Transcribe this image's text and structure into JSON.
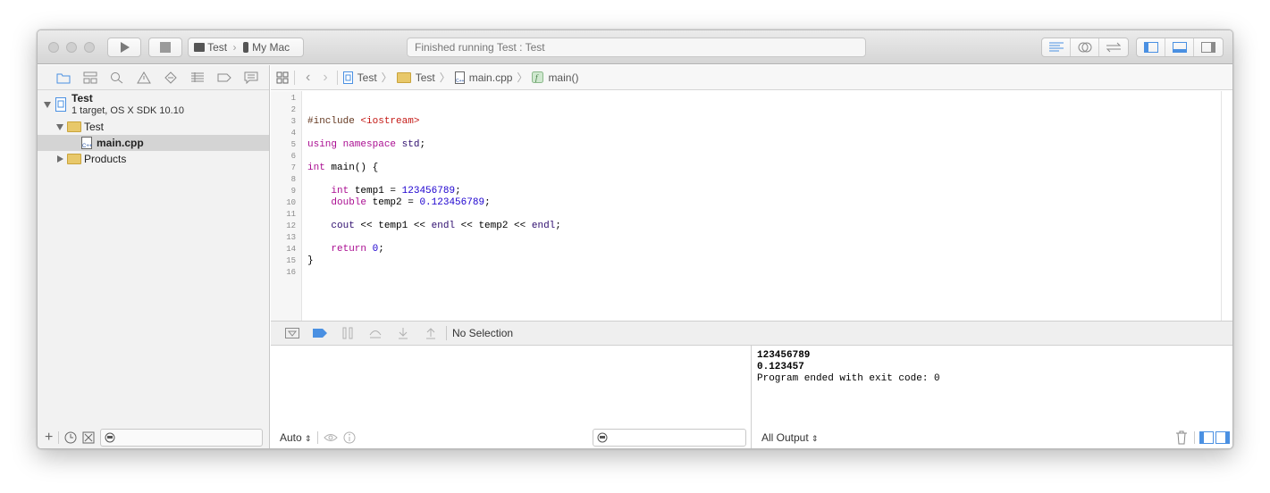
{
  "toolbar": {
    "scheme_target": "Test",
    "scheme_destination": "My Mac",
    "status": "Finished running Test : Test"
  },
  "navigator": {
    "project_name": "Test",
    "project_subtitle": "1 target, OS X SDK 10.10",
    "items": [
      {
        "label": "Test"
      },
      {
        "label": "main.cpp"
      },
      {
        "label": "Products"
      }
    ]
  },
  "jumpbar": {
    "crumbs": [
      "Test",
      "Test",
      "main.cpp",
      "main()"
    ]
  },
  "editor": {
    "line_numbers": [
      "1",
      "2",
      "3",
      "4",
      "5",
      "6",
      "7",
      "8",
      "9",
      "10",
      "11",
      "12",
      "13",
      "14",
      "15",
      "16"
    ]
  },
  "debug": {
    "selection": "No Selection"
  },
  "variables": {
    "mode": "Auto"
  },
  "console": {
    "lines": [
      "123456789",
      "0.123457",
      "Program ended with exit code: 0"
    ],
    "output_mode": "All Output"
  },
  "colors": {
    "accent": "#4a90e2",
    "keyword": "#aa0d91",
    "string": "#c41a16",
    "number": "#1c00cf"
  }
}
